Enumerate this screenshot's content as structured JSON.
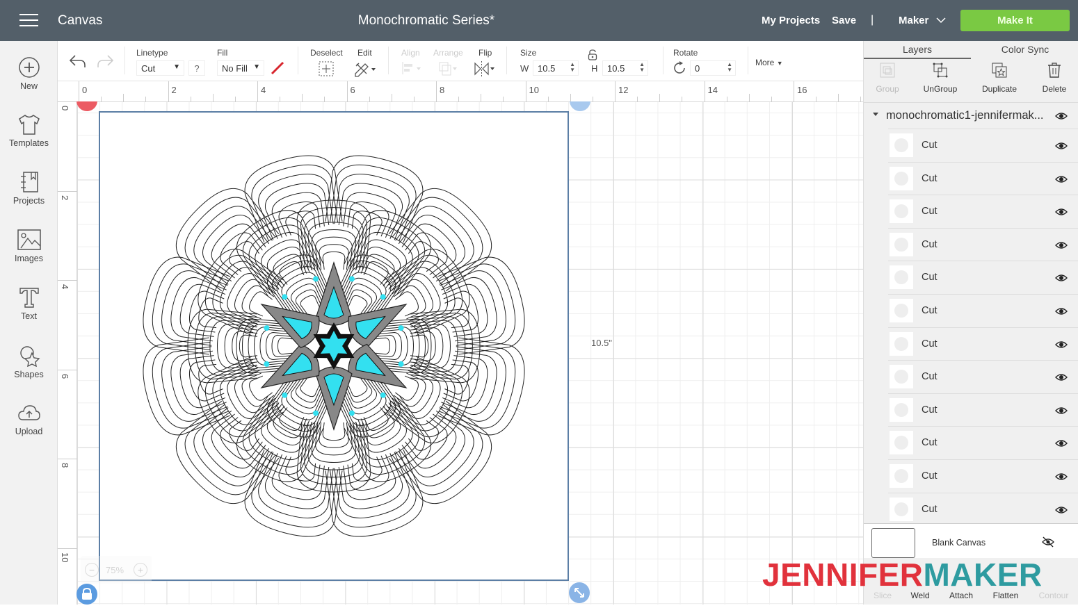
{
  "topbar": {
    "app_title": "Canvas",
    "doc_title": "Monochromatic Series*",
    "my_projects": "My Projects",
    "save": "Save",
    "separator": "|",
    "machine": "Maker",
    "make_it": "Make It",
    "make_it_color": "#7ac943"
  },
  "sidebar": {
    "items": [
      {
        "label": "New",
        "icon": "plus-circle-icon"
      },
      {
        "label": "Templates",
        "icon": "tshirt-icon"
      },
      {
        "label": "Projects",
        "icon": "notebook-icon"
      },
      {
        "label": "Images",
        "icon": "image-icon"
      },
      {
        "label": "Text",
        "icon": "text-icon"
      },
      {
        "label": "Shapes",
        "icon": "shapes-icon"
      },
      {
        "label": "Upload",
        "icon": "cloud-upload-icon"
      }
    ]
  },
  "toolbar": {
    "linetype_label": "Linetype",
    "linetype_value": "Cut",
    "help": "?",
    "fill_label": "Fill",
    "fill_value": "No Fill",
    "deselect_label": "Deselect",
    "edit_label": "Edit",
    "align_label": "Align",
    "arrange_label": "Arrange",
    "flip_label": "Flip",
    "size_label": "Size",
    "w_label": "W",
    "w_value": "10.5",
    "h_label": "H",
    "h_value": "10.5",
    "rotate_label": "Rotate",
    "rotate_value": "0",
    "more_label": "More"
  },
  "rulers": {
    "top": [
      "0",
      "2",
      "4",
      "6",
      "8",
      "10",
      "12",
      "14",
      "16"
    ],
    "left": [
      "0",
      "2",
      "4",
      "6",
      "8",
      "10"
    ]
  },
  "canvas": {
    "dimension_label": "10.5\"",
    "zoom_level": "75%",
    "accent_color": "#33e0f0"
  },
  "panel": {
    "tabs": [
      "Layers",
      "Color Sync"
    ],
    "actions": [
      {
        "label": "Group",
        "enabled": false
      },
      {
        "label": "UnGroup",
        "enabled": true
      },
      {
        "label": "Duplicate",
        "enabled": true
      },
      {
        "label": "Delete",
        "enabled": true
      }
    ],
    "group_name": "monochromatic1-jennifermak...",
    "layers": [
      "Cut",
      "Cut",
      "Cut",
      "Cut",
      "Cut",
      "Cut",
      "Cut",
      "Cut",
      "Cut",
      "Cut",
      "Cut",
      "Cut"
    ],
    "blank_canvas": "Blank Canvas",
    "bottom_actions": [
      {
        "label": "Slice",
        "enabled": false
      },
      {
        "label": "Weld",
        "enabled": true
      },
      {
        "label": "Attach",
        "enabled": true
      },
      {
        "label": "Flatten",
        "enabled": true
      },
      {
        "label": "Contour",
        "enabled": false
      }
    ]
  },
  "watermark": {
    "part1": "JENNIFER",
    "part2": "MAKER",
    "color1": "#e1323c",
    "color2": "#2e9ba0"
  }
}
